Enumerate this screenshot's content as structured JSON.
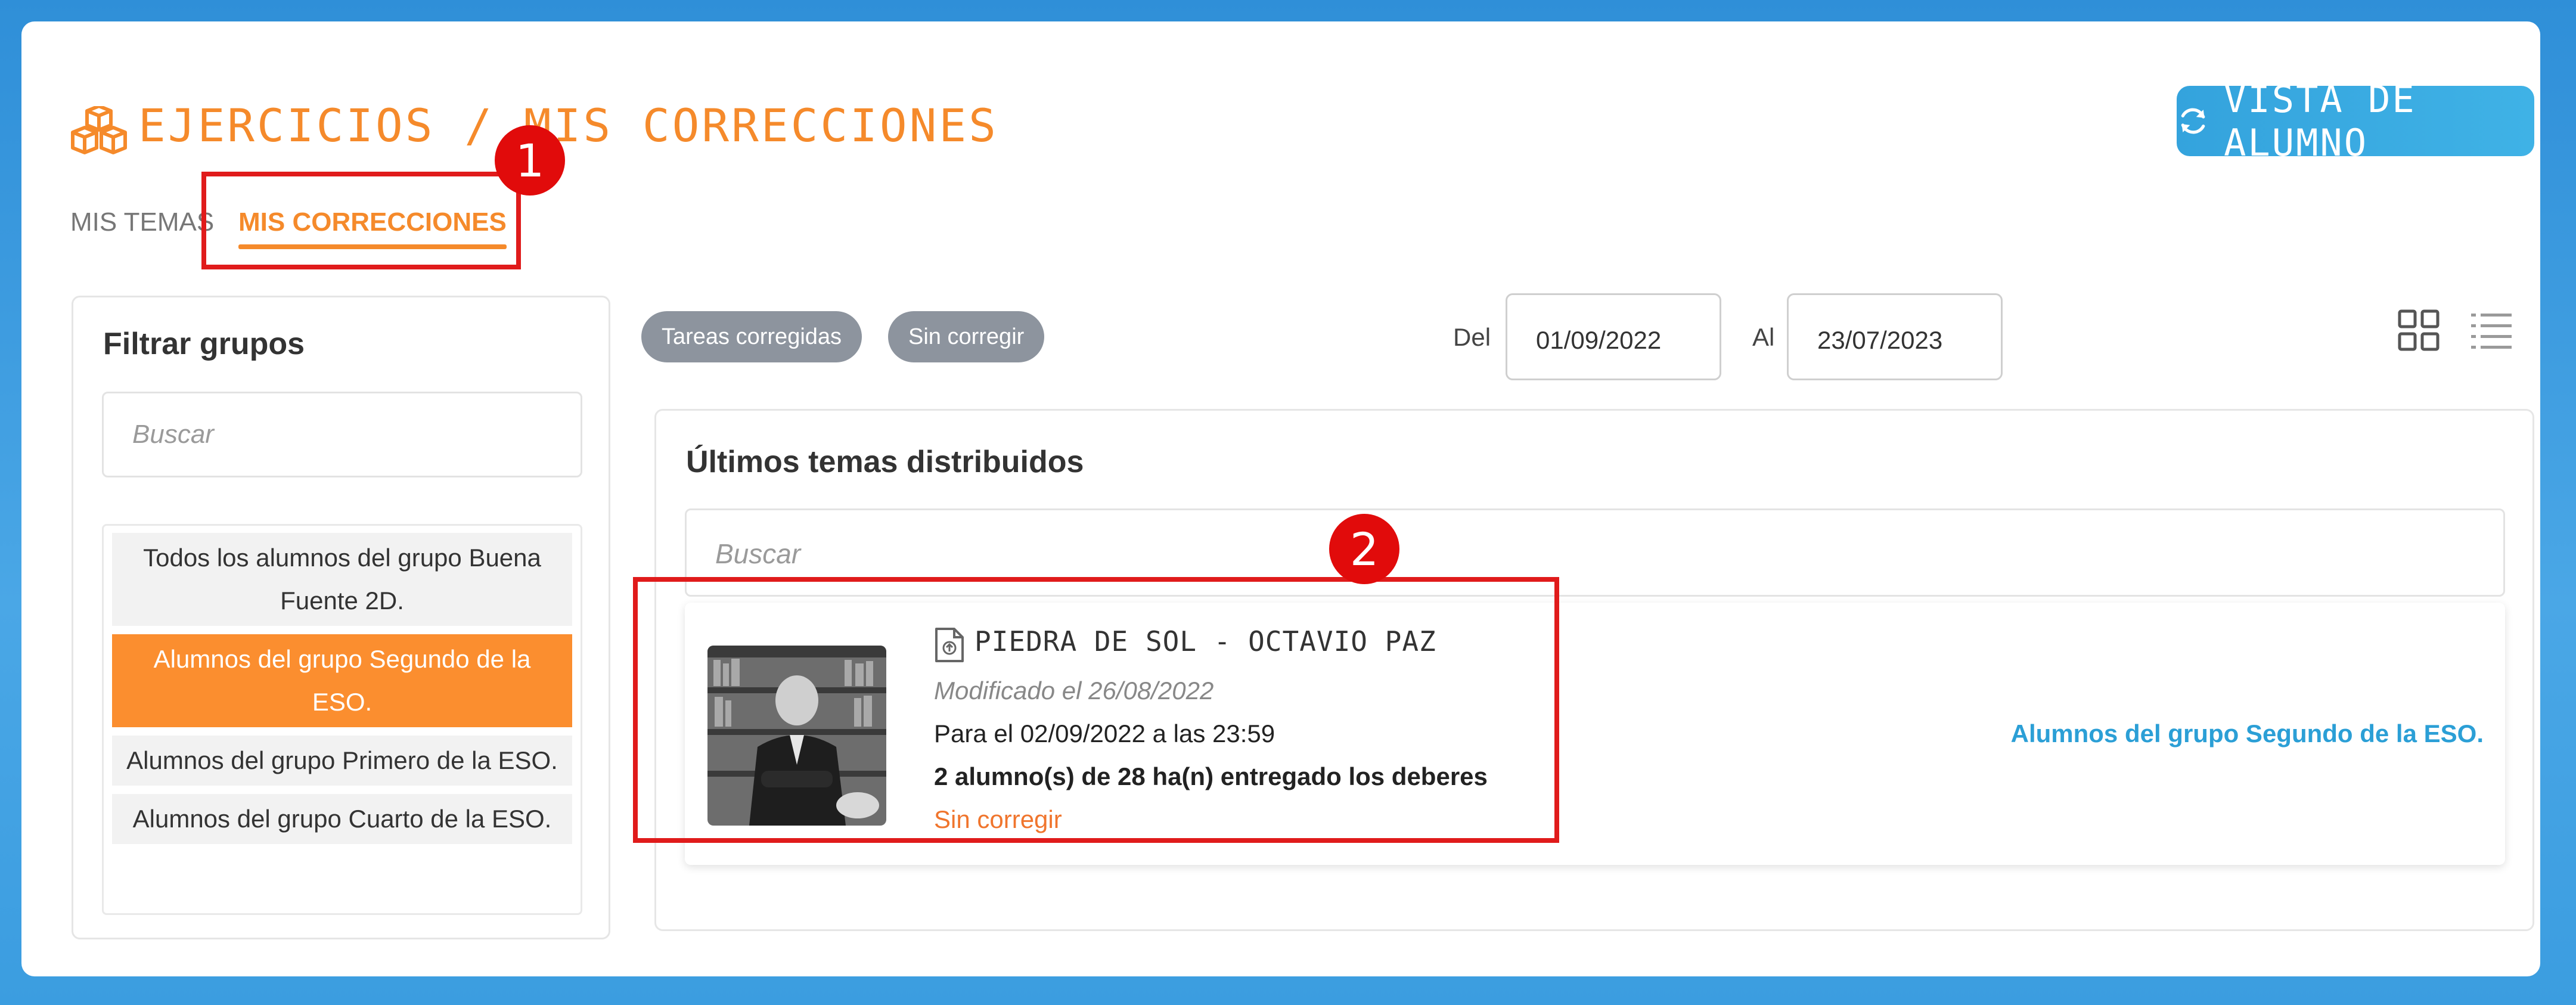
{
  "header": {
    "title": "EJERCICIOS / MIS CORRECCIONES",
    "student_view_label": "VISTA DE ALUMNO"
  },
  "tabs": [
    {
      "label": "MIS TEMAS",
      "active": false
    },
    {
      "label": "MIS CORRECCIONES",
      "active": true
    }
  ],
  "annotations": {
    "marker_1": "1",
    "marker_2": "2",
    "highlight_color": "#e01b1b"
  },
  "sidebar": {
    "title": "Filtrar grupos",
    "search_placeholder": "Buscar",
    "groups": [
      {
        "label": "Todos los alumnos del grupo Buena Fuente 2D.",
        "active": false
      },
      {
        "label": "Alumnos del grupo Segundo de la ESO.",
        "active": true
      },
      {
        "label": "Alumnos del grupo Primero de la ESO.",
        "active": false
      },
      {
        "label": "Alumnos del grupo Cuarto de la ESO.",
        "active": false
      }
    ]
  },
  "filters": {
    "chip_corrected": "Tareas corregidas",
    "chip_uncorrected": "Sin corregir",
    "from_label": "Del",
    "from_date": "01/09/2022",
    "to_label": "Al",
    "to_date": "23/07/2023"
  },
  "main": {
    "title": "Últimos temas distribuidos",
    "search_placeholder": "Buscar",
    "items": [
      {
        "title": "PIEDRA DE SOL - OCTAVIO PAZ",
        "modified": "Modificado el 26/08/2022",
        "due": "Para el 02/09/2022 a las 23:59",
        "delivered": "2 alumno(s) de 28 ha(n) entregado los deberes",
        "status": "Sin corregir",
        "group": "Alumnos del grupo Segundo de la ESO."
      }
    ]
  },
  "colors": {
    "accent_orange": "#f58a2b",
    "accent_blue": "#34a3dd",
    "chip_gray": "#8d949e",
    "status_orange": "#f0752d"
  },
  "icons": [
    "cubes-icon",
    "refresh-icon",
    "grid-view-icon",
    "list-view-icon",
    "document-icon"
  ]
}
